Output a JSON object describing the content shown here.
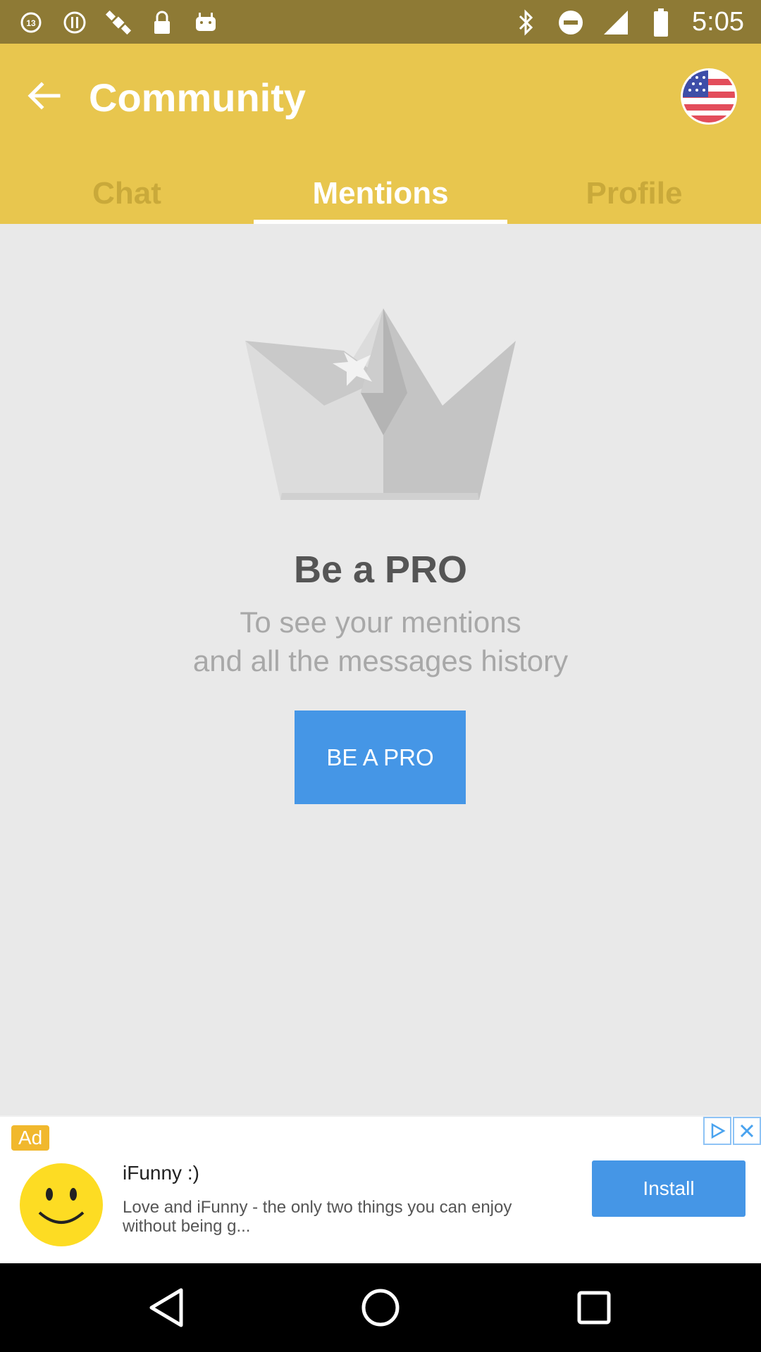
{
  "status_bar": {
    "time": "5:05",
    "left_icons": [
      "abc13-news-icon",
      "alert-circle-icon",
      "fake-gps-satellite-icon",
      "lock-icon",
      "android-icon"
    ],
    "right_icons": [
      "bluetooth-icon",
      "do-not-disturb-icon",
      "signal-icon",
      "battery-icon"
    ]
  },
  "app_bar": {
    "title": "Community",
    "back_icon": "arrow-back-icon",
    "language_icon": "us-flag-icon",
    "tabs": [
      {
        "label": "Chat",
        "active": false
      },
      {
        "label": "Mentions",
        "active": true
      },
      {
        "label": "Profile",
        "active": false
      }
    ]
  },
  "main": {
    "illustration": "crown-icon",
    "title": "Be a PRO",
    "subtitle_line1": "To see your mentions",
    "subtitle_line2": "and all the messages history",
    "button_label": "BE A PRO"
  },
  "ad": {
    "badge": "Ad",
    "app_name": "iFunny :)",
    "description": "Love and iFunny - the only two things you can enjoy without being g...",
    "install_label": "Install"
  },
  "colors": {
    "status_bar": "#8e7a35",
    "app_bar": "#e8c64e",
    "accent_blue": "#4596e6",
    "background": "#e9e9e9"
  }
}
